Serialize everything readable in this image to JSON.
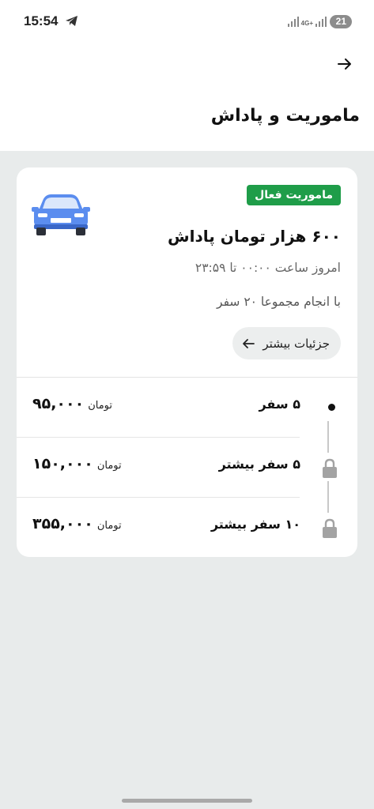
{
  "status_bar": {
    "time": "15:54",
    "network_label": "4G+",
    "battery": "21",
    "icons": [
      "telegram-icon",
      "signal-icon",
      "battery-icon"
    ]
  },
  "header": {
    "title": "ماموریت و پاداش",
    "back_icon": "arrow-right-icon"
  },
  "mission": {
    "badge": "ماموریت فعال",
    "reward_title": "۶۰۰ هزار تومان پاداش",
    "time_range": "امروز ساعت ۰۰:۰۰ تا ۲۳:۵۹",
    "total_trips": "با انجام مجموعا ۲۰ سفر",
    "details_label": "جزئیات بیشتر",
    "car_icon": "car-icon",
    "tiers": [
      {
        "trips": "۵ سفر",
        "amount": "۹۵,۰۰۰",
        "unit": "تومان",
        "status_icon": "dot-icon"
      },
      {
        "trips": "۵ سفر بیشتر",
        "amount": "۱۵۰,۰۰۰",
        "unit": "تومان",
        "status_icon": "lock-icon"
      },
      {
        "trips": "۱۰ سفر بیشتر",
        "amount": "۳۵۵,۰۰۰",
        "unit": "تومان",
        "status_icon": "lock-icon"
      }
    ]
  },
  "colors": {
    "active_badge": "#1f9d49",
    "car": "#5b8def",
    "background": "#e8ebeb"
  }
}
